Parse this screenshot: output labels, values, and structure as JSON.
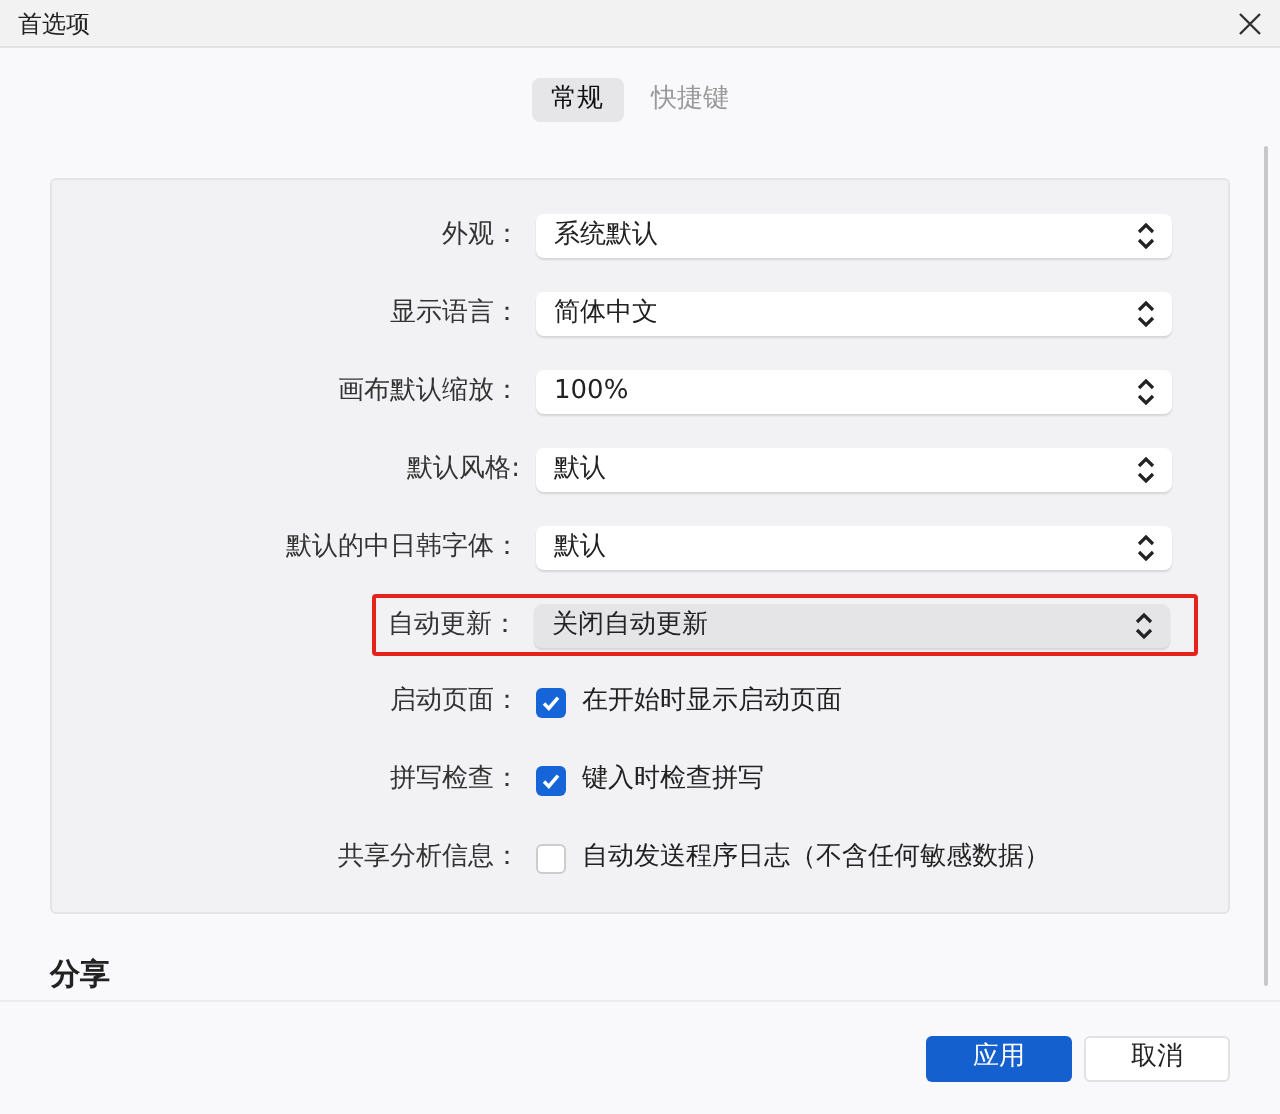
{
  "window": {
    "title": "首选项"
  },
  "tabs": [
    {
      "label": "常规",
      "selected": true
    },
    {
      "label": "快捷键",
      "selected": false
    }
  ],
  "settings": [
    {
      "kind": "select",
      "label": "外观：",
      "value": "系统默认",
      "highlighted": false
    },
    {
      "kind": "select",
      "label": "显示语言：",
      "value": "简体中文",
      "highlighted": false
    },
    {
      "kind": "select",
      "label": "画布默认缩放：",
      "value": "100%",
      "highlighted": false
    },
    {
      "kind": "select",
      "label": "默认风格:",
      "value": "默认",
      "highlighted": false
    },
    {
      "kind": "select",
      "label": "默认的中日韩字体：",
      "value": "默认",
      "highlighted": false
    },
    {
      "kind": "select",
      "label": "自动更新：",
      "value": "关闭自动更新",
      "highlighted": true
    },
    {
      "kind": "checkbox",
      "label": "启动页面：",
      "text": "在开始时显示启动页面",
      "checked": true
    },
    {
      "kind": "checkbox",
      "label": "拼写检查：",
      "text": "键入时检查拼写",
      "checked": true
    },
    {
      "kind": "checkbox",
      "label": "共享分析信息：",
      "text": "自动发送程序日志（不含任何敏感数据）",
      "checked": false
    }
  ],
  "section": {
    "title": "分享"
  },
  "buttons": [
    {
      "label": "应用",
      "primary": true
    },
    {
      "label": "取消",
      "primary": false
    }
  ]
}
